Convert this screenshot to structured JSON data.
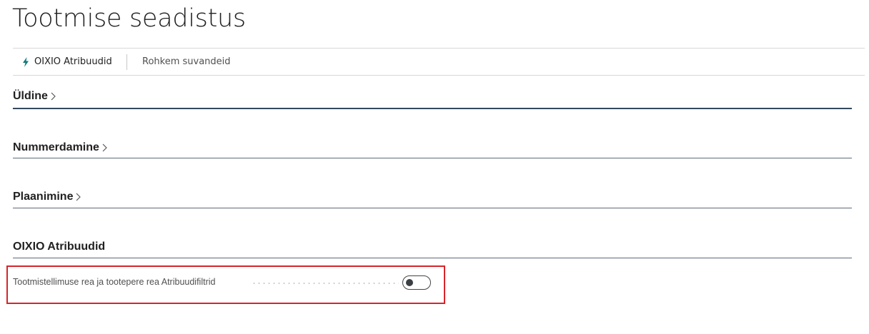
{
  "page": {
    "title": "Tootmise seadistus"
  },
  "actions": {
    "oixio_label": "OIXIO Atribuudid",
    "oixio_icon": "lightning-bolt-icon",
    "more_label": "Rohkem suvandeid"
  },
  "sections": {
    "uldine": {
      "label": "Üldine",
      "icon": "chevron-right-icon"
    },
    "nummerdamine": {
      "label": "Nummerdamine",
      "icon": "chevron-right-icon"
    },
    "plaanimine": {
      "label": "Plaanimine",
      "icon": "chevron-right-icon"
    },
    "oixio": {
      "label": "OIXIO Atribuudid"
    }
  },
  "fields": {
    "atribuudifiltrid": {
      "label": "Tootmistellimuse rea ja tootepere rea Atribuudifiltrid",
      "value": "off"
    }
  },
  "colors": {
    "accent": "#0f7a7a",
    "highlight": "#d7242a",
    "section_rule": "#34495e"
  }
}
